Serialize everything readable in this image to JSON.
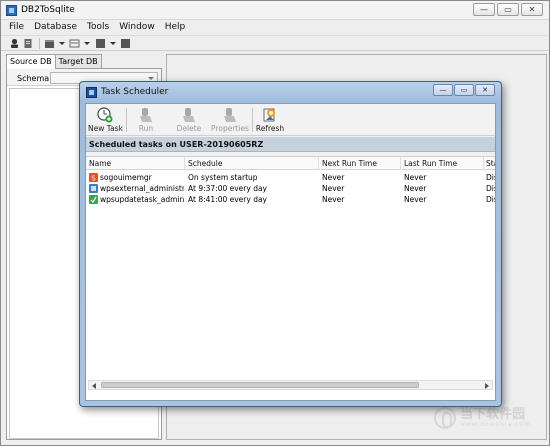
{
  "app": {
    "title": "DB2ToSqlite"
  },
  "window_controls": {
    "minimize": "—",
    "restore": "▭",
    "close": "✕"
  },
  "menu": [
    "File",
    "Database",
    "Tools",
    "Window",
    "Help"
  ],
  "left_panel": {
    "tabs": [
      {
        "label": "Source DB",
        "active": true
      },
      {
        "label": "Target DB",
        "active": false
      }
    ],
    "schema_label": "Schema",
    "schema_value": ""
  },
  "dialog": {
    "title": "Task Scheduler",
    "controls": {
      "minimize": "—",
      "restore": "▭",
      "close": "✕"
    },
    "toolbar": [
      {
        "label": "New Task",
        "enabled": true,
        "icon": "new-task-icon"
      },
      {
        "label": "Run",
        "enabled": false,
        "icon": "run-icon"
      },
      {
        "label": "Delete",
        "enabled": false,
        "icon": "delete-icon"
      },
      {
        "label": "Properties",
        "enabled": false,
        "icon": "properties-icon"
      },
      {
        "label": "Refresh",
        "enabled": true,
        "icon": "refresh-icon"
      }
    ],
    "header": "Scheduled tasks on USER-20190605RZ",
    "columns": [
      "Name",
      "Schedule",
      "Next Run Time",
      "Last Run Time",
      "Sta"
    ],
    "rows": [
      {
        "icon": "sogou-task-icon",
        "name": "sogouimemgr",
        "schedule": "On system startup",
        "next": "Never",
        "last": "Never",
        "status": "Dis"
      },
      {
        "icon": "wps-task-icon",
        "name": "wpsexternal_administr...",
        "schedule": "At 9:37:00 every day",
        "next": "Never",
        "last": "Never",
        "status": "Dis"
      },
      {
        "icon": "wps-update-task-icon",
        "name": "wpsupdatetask_admini...",
        "schedule": "At 8:41:00 every day",
        "next": "Never",
        "last": "Never",
        "status": "Dis"
      }
    ]
  },
  "watermark": {
    "text": "当下软件园",
    "sub": "www.downxia.com"
  },
  "colors": {
    "dialog_frame": "#a9c4e2",
    "header_band": "#c6d1dc",
    "new_task_accent": "#2e9d2e",
    "refresh_accent": "#e8a317"
  }
}
